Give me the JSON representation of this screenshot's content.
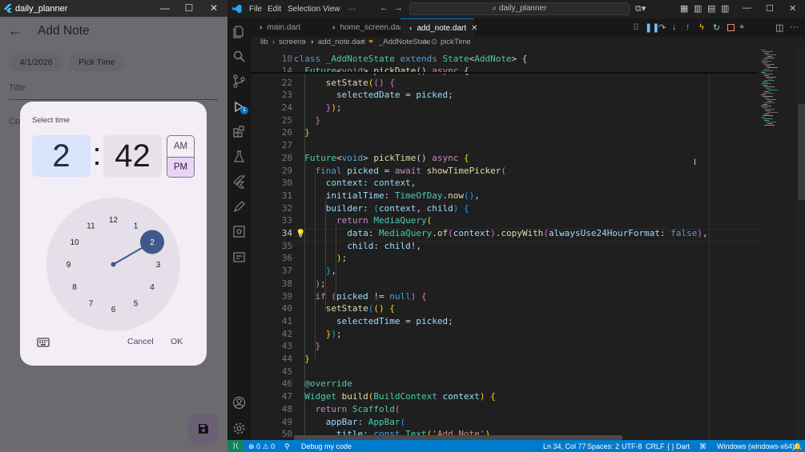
{
  "app": {
    "window_title": "daily_planner",
    "appbar_title": "Add Note",
    "date_chip": "4/1/2026",
    "pick_time_chip": "Pick Time",
    "title_field_label": "Title",
    "content_field_label_partial": "Co",
    "dialog": {
      "heading": "Select time",
      "hour": "2",
      "separator": ":",
      "minute": "42",
      "am": "AM",
      "pm": "PM",
      "selected_period": "PM",
      "dial_numbers": [
        "12",
        "1",
        "2",
        "3",
        "4",
        "5",
        "6",
        "7",
        "8",
        "9",
        "10",
        "11"
      ],
      "selected_hour": "2",
      "cancel": "Cancel",
      "ok": "OK"
    },
    "colors": {
      "accent_hour_bg": "#d9e3fb",
      "pm_bg": "#e9d4f7",
      "dial_selected": "#3e5a8a"
    }
  },
  "vscode": {
    "menu": [
      "File",
      "Edit",
      "Selection",
      "View",
      "···"
    ],
    "search_text": "daily_planner",
    "tabs": [
      {
        "label": "main.dart",
        "active": false
      },
      {
        "label": "home_screen.dart",
        "active": false
      },
      {
        "label": "add_note.dart",
        "active": true
      }
    ],
    "breadcrumb": [
      "lib",
      "screens",
      "add_note.dart",
      "_AddNoteState",
      "pickTime"
    ],
    "line_numbers": [
      "10",
      "14",
      "22",
      "23",
      "24",
      "25",
      "26",
      "27",
      "28",
      "29",
      "30",
      "31",
      "32",
      "33",
      "34",
      "35",
      "36",
      "37",
      "38",
      "39",
      "40",
      "41",
      "42",
      "43",
      "44",
      "45",
      "46",
      "47",
      "48",
      "49",
      "50"
    ],
    "active_line": "34",
    "debug_badge": "1",
    "status": {
      "errors": "0",
      "warnings": "0",
      "debug": "Debug my code",
      "position": "Ln 34, Col 77",
      "spaces": "Spaces: 2",
      "encoding": "UTF-8",
      "eol": "CRLF",
      "language": "{ } Dart",
      "platform": "Windows (windows-x64)"
    }
  }
}
